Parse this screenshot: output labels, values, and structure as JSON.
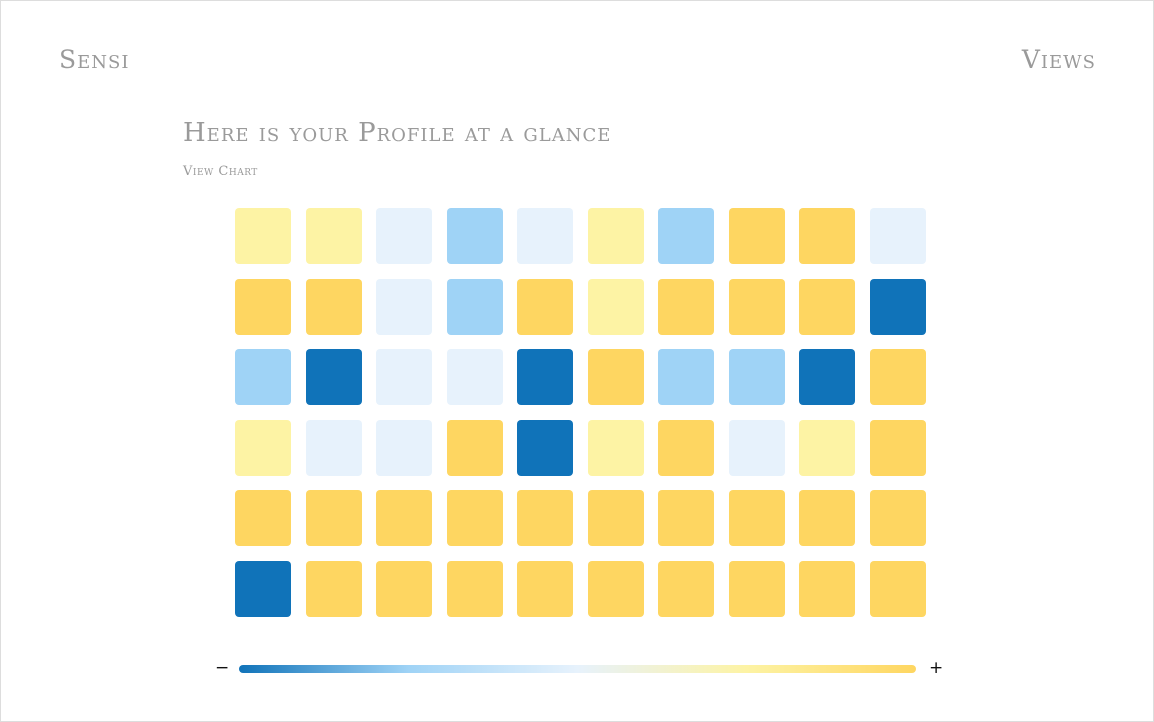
{
  "header": {
    "brand": "Sensi",
    "views_label": "Views"
  },
  "main": {
    "title": "Here is your Profile at a glance",
    "view_chart_label": "View Chart"
  },
  "colors": {
    "level_1": "#1073b9",
    "level_2": "#9fd3f6",
    "level_3": "#e7f2fc",
    "level_4": "#fdf3a4",
    "level_5": "#fed661",
    "gradient": [
      "#1073b9",
      "#9fd3f6",
      "#e7f2fc",
      "#fdf3a4",
      "#fed661"
    ]
  },
  "legend": {
    "minus_label": "−",
    "plus_label": "+"
  },
  "chart_data": {
    "type": "heatmap",
    "rows": 6,
    "columns": 10,
    "scale_min": 1,
    "scale_max": 5,
    "values": [
      [
        4,
        4,
        3,
        2,
        3,
        4,
        2,
        5,
        5,
        3
      ],
      [
        5,
        5,
        3,
        2,
        5,
        4,
        5,
        5,
        5,
        1
      ],
      [
        2,
        1,
        3,
        3,
        1,
        5,
        2,
        2,
        1,
        5
      ],
      [
        4,
        3,
        3,
        5,
        1,
        4,
        5,
        3,
        4,
        5
      ],
      [
        5,
        5,
        5,
        5,
        5,
        5,
        5,
        5,
        5,
        5
      ],
      [
        1,
        5,
        5,
        5,
        5,
        5,
        5,
        5,
        5,
        5
      ]
    ]
  }
}
